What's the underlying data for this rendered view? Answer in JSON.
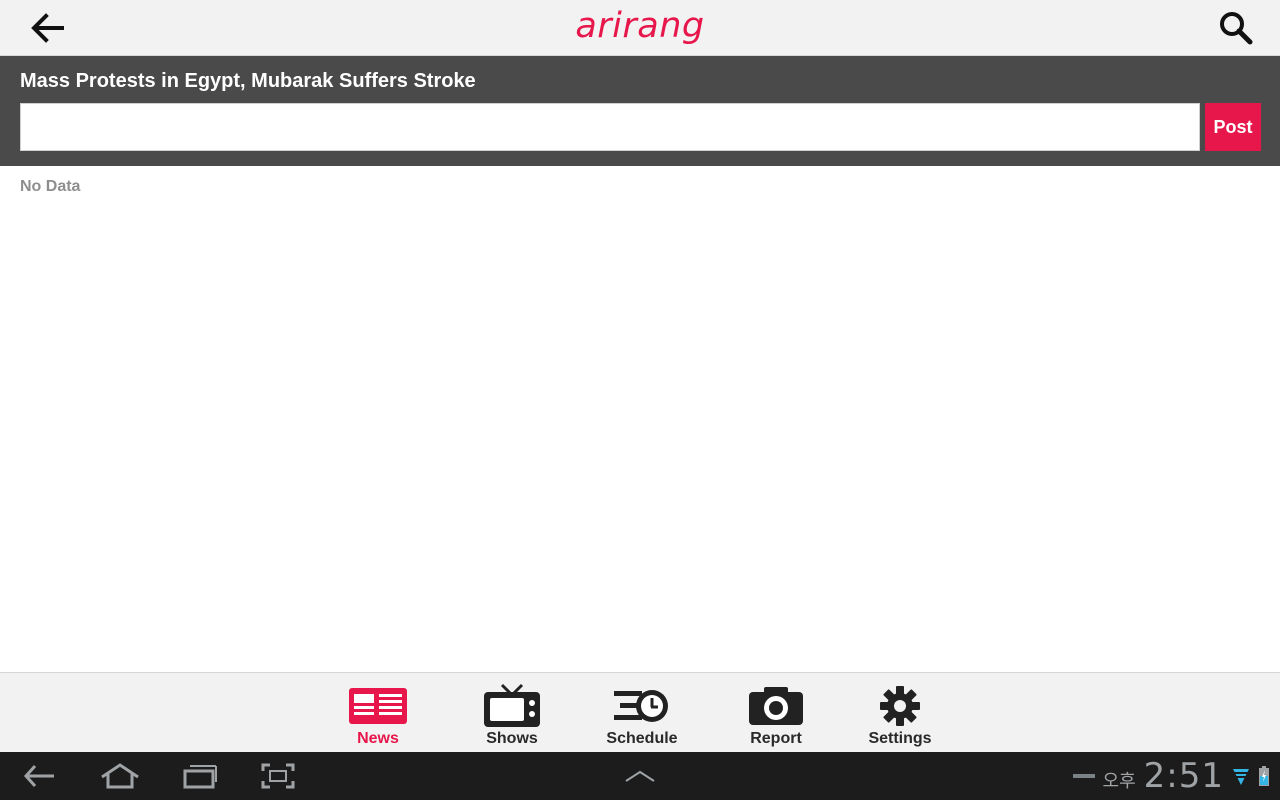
{
  "colors": {
    "brand": "#e8174b",
    "header_dark": "#4a4a4a",
    "bar_light": "#f2f2f2",
    "system_bar": "#1c1c1c",
    "status_icon": "#33b5e5"
  },
  "topbar": {
    "logo_text": "arirang",
    "back_icon": "arrow-left-icon",
    "search_icon": "search-icon"
  },
  "article": {
    "title": "Mass Protests in Egypt, Mubarak Suffers Stroke"
  },
  "comment": {
    "input_value": "",
    "post_label": "Post"
  },
  "content": {
    "empty_message": "No Data"
  },
  "tabs": [
    {
      "label": "News",
      "icon": "newspaper-icon",
      "active": true
    },
    {
      "label": "Shows",
      "icon": "tv-icon",
      "active": false
    },
    {
      "label": "Schedule",
      "icon": "schedule-clock-icon",
      "active": false
    },
    {
      "label": "Report",
      "icon": "camera-icon",
      "active": false
    },
    {
      "label": "Settings",
      "icon": "gear-icon",
      "active": false
    }
  ],
  "system_bar": {
    "ampm": "오후",
    "time": "2:51",
    "icons": [
      "back-icon",
      "home-icon",
      "recent-apps-icon",
      "screenshot-icon",
      "chevron-up-icon",
      "wifi-icon",
      "battery-icon"
    ]
  }
}
